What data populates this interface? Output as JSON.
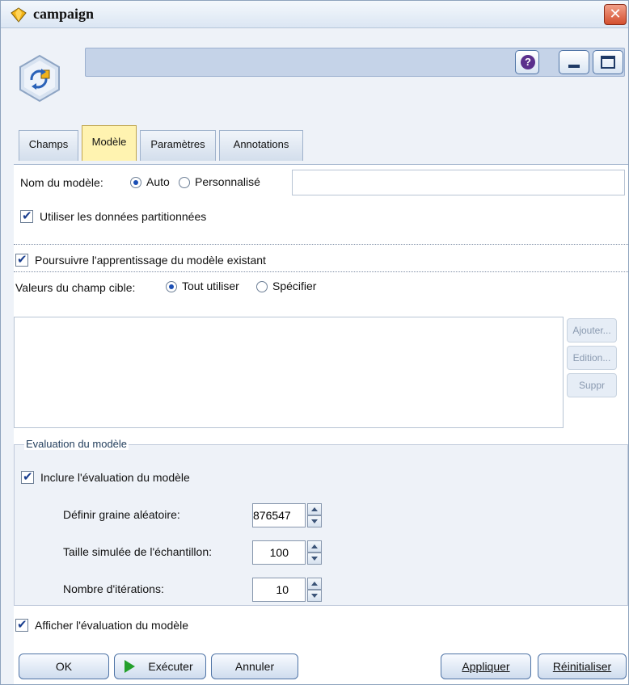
{
  "window": {
    "title": "campaign"
  },
  "tabs": [
    {
      "label": "Champs"
    },
    {
      "label": "Modèle"
    },
    {
      "label": "Paramètres"
    },
    {
      "label": "Annotations"
    }
  ],
  "model": {
    "name_label": "Nom du modèle:",
    "auto_label": "Auto",
    "custom_label": "Personnalisé",
    "selected": "Auto",
    "name_value": "",
    "use_partitioned_label": "Utiliser les données partitionnées",
    "use_partitioned_checked": true,
    "continue_training_label": "Poursuivre l'apprentissage du modèle existant",
    "continue_training_checked": true,
    "target_values_label": "Valeurs du champ cible:",
    "use_all_label": "Tout utiliser",
    "specify_label": "Spécifier",
    "target_selected": "Tout utiliser"
  },
  "side_buttons": {
    "add_label": "Ajouter...",
    "edit_label": "Edition...",
    "delete_label": "Suppr"
  },
  "evaluation": {
    "group_title": "Evaluation du modèle",
    "include_label": "Inclure l'évaluation du modèle",
    "include_checked": true,
    "seed_label": "Définir graine aléatoire:",
    "seed_value": "876547",
    "sample_label": "Taille simulée de l'échantillon:",
    "sample_value": "100",
    "iterations_label": "Nombre d'itérations:",
    "iterations_value": "10"
  },
  "show_evaluation_label": "Afficher l'évaluation du modèle",
  "show_evaluation_checked": true,
  "buttons": {
    "ok": "OK",
    "run": "Exécuter",
    "cancel": "Annuler",
    "apply": "Appliquer",
    "reset": "Réinitialiser"
  },
  "colors": {
    "active_tab": "#fff3b0",
    "accent": "#1b4fb5",
    "run_icon": "#24a02c",
    "close": "#d34f2f"
  },
  "icons": [
    "diamond-app-icon",
    "model-node-icon",
    "help-icon",
    "minimize-icon",
    "maximize-icon",
    "close-icon",
    "play-icon"
  ]
}
